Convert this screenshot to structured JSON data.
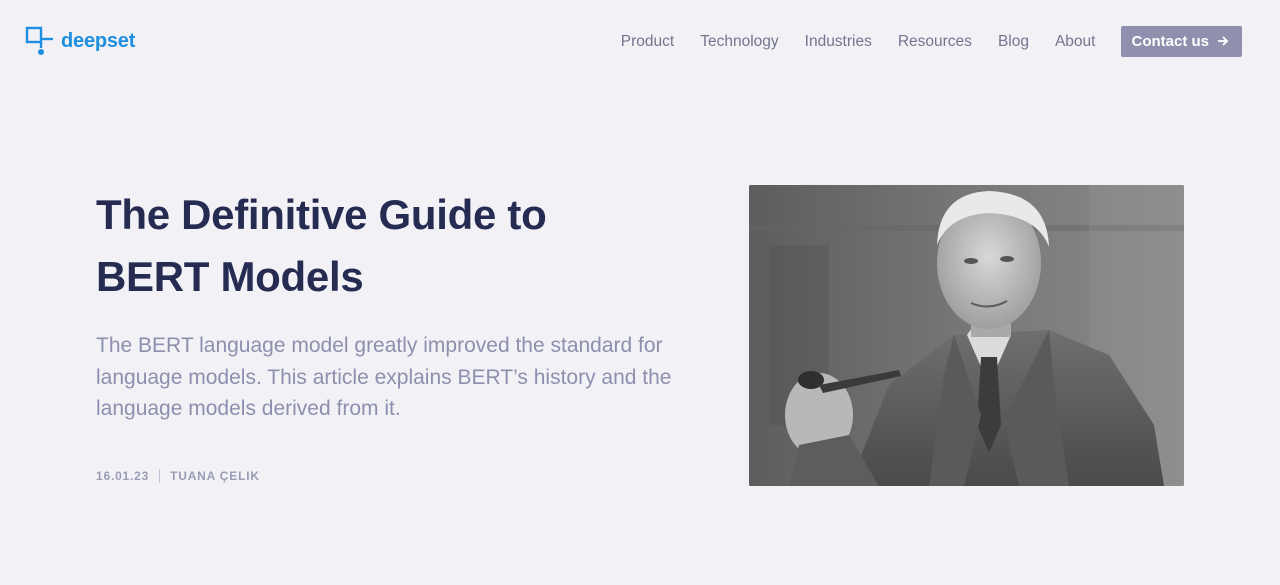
{
  "header": {
    "logo": {
      "name": "deepset",
      "icon": "deepset-logo-icon"
    },
    "nav": [
      {
        "label": "Product"
      },
      {
        "label": "Technology"
      },
      {
        "label": "Industries"
      },
      {
        "label": "Resources"
      },
      {
        "label": "Blog"
      },
      {
        "label": "About"
      }
    ],
    "cta": {
      "label": "Contact us",
      "icon": "arrow-right-icon"
    }
  },
  "article": {
    "title": "The Definitive Guide to BERT Models",
    "summary": "The BERT language model greatly improved the standard for language models. This article explains BERT’s history and the language models derived from it.",
    "date": "16.01.23",
    "author": "TUANA ÇELIK",
    "image": {
      "kind": "black-and-white portrait photo",
      "subject": "man in tweed suit holding a pipe"
    }
  },
  "colors": {
    "background": "#f2f2f6",
    "brand": "#1e8fe0",
    "title": "#262b52",
    "muted": "#8d8fae",
    "button": "#8f90ad"
  }
}
